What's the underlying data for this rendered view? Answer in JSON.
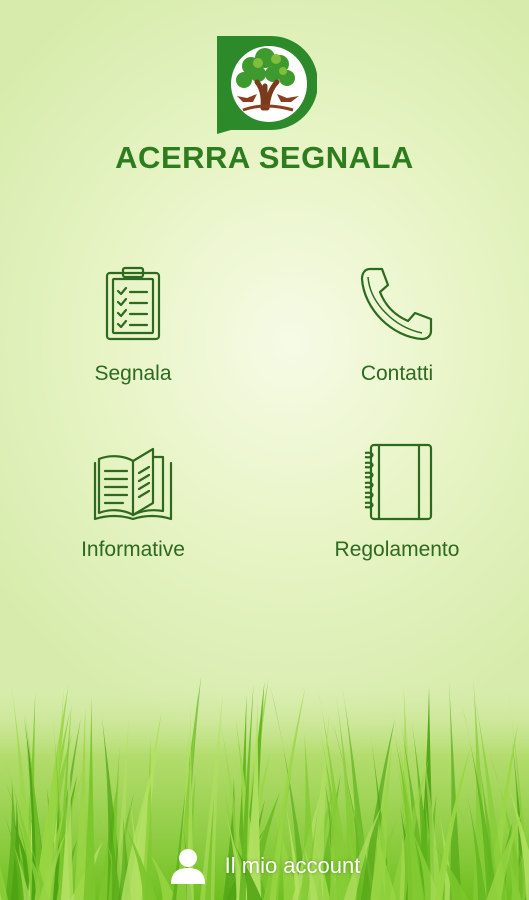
{
  "app": {
    "title": "ACERRA SEGNALA",
    "brand_color": "#2d7c1e"
  },
  "menu": {
    "segnala": {
      "label": "Segnala",
      "icon": "clipboard-checklist-icon"
    },
    "contatti": {
      "label": "Contatti",
      "icon": "phone-handset-icon"
    },
    "informative": {
      "label": "Informative",
      "icon": "open-book-icon"
    },
    "regolamento": {
      "label": "Regolamento",
      "icon": "spiral-notebook-icon"
    }
  },
  "footer": {
    "account_label": "Il mio account",
    "icon": "user-icon"
  }
}
